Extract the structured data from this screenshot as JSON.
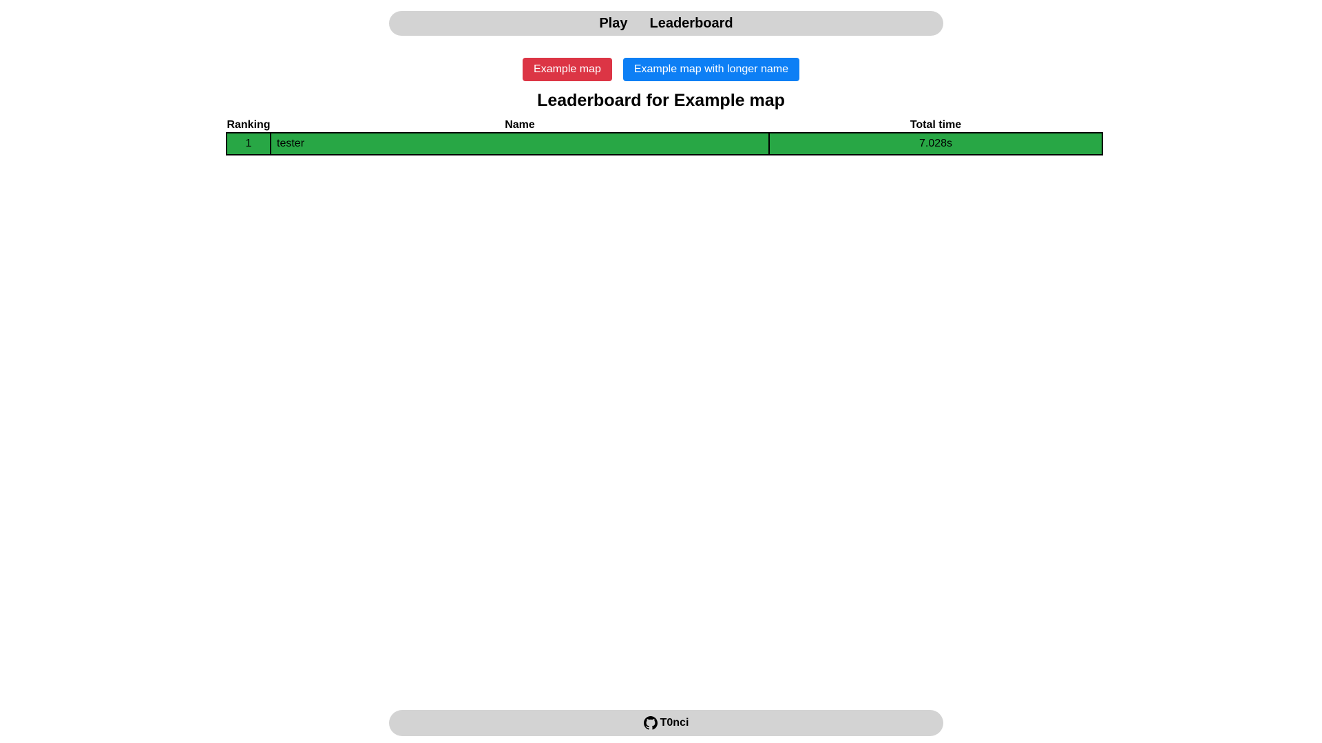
{
  "nav": {
    "play_label": "Play",
    "leaderboard_label": "Leaderboard"
  },
  "maps": {
    "active_label": "Example map",
    "other_label": "Example map with longer name"
  },
  "leaderboard": {
    "title": "Leaderboard for Example map",
    "columns": {
      "ranking": "Ranking",
      "name": "Name",
      "total_time": "Total time"
    },
    "rows": [
      {
        "ranking": "1",
        "name": "tester",
        "total_time": "7.028s"
      }
    ]
  },
  "footer": {
    "author": "T0nci",
    "icon": "github-icon"
  },
  "colors": {
    "active_map": "#dc3545",
    "other_map": "#0d7ff5",
    "row_highlight": "#28a745",
    "bar_background": "#d3d3d3"
  }
}
